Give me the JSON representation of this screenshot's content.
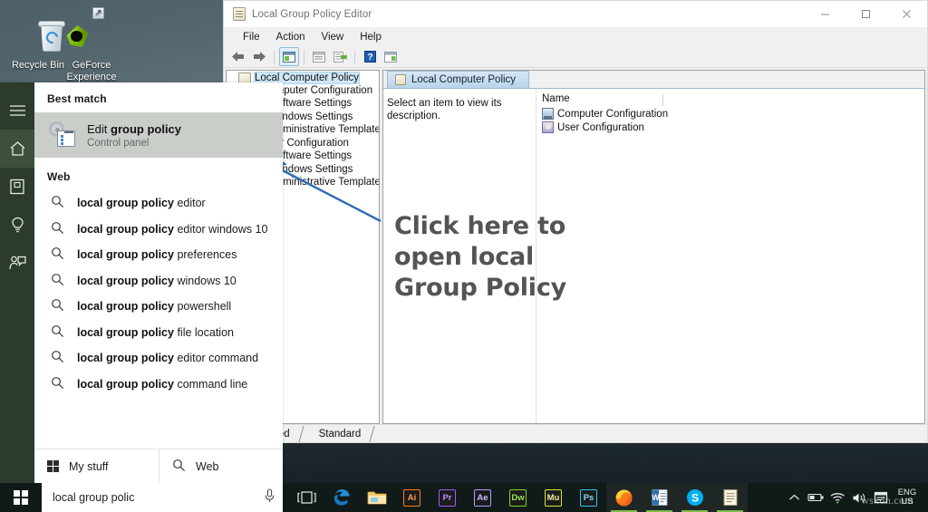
{
  "desktop": {
    "icons": [
      {
        "label": "Recycle Bin",
        "icon": "recycle-bin-icon"
      },
      {
        "label": "GeForce Experience",
        "icon": "geforce-experience-icon"
      }
    ]
  },
  "gpe_window": {
    "title": "Local Group Policy Editor",
    "title_icon": "group-policy-document-icon",
    "window_controls": {
      "minimize": "minimize-icon",
      "maximize": "maximize-icon",
      "close": "close-icon"
    },
    "menu": [
      "File",
      "Action",
      "View",
      "Help"
    ],
    "toolbar": [
      "back-arrow-icon",
      "forward-arrow-icon",
      "show-hide-console-tree-icon",
      "properties-icon",
      "export-list-icon",
      "help-icon",
      "show-hide-action-pane-icon"
    ],
    "tree": {
      "root": {
        "label": "Local Computer Policy",
        "icon": "policy-icon",
        "selected": true
      },
      "nodes": [
        {
          "label": "Computer Configuration",
          "icon": "computer-icon",
          "expander": "v",
          "indent": 1
        },
        {
          "label": "Software Settings",
          "icon": "folder-icon",
          "indent": 2
        },
        {
          "label": "Windows Settings",
          "icon": "folder-icon",
          "indent": 2
        },
        {
          "label": "Administrative Templates",
          "icon": "folder-icon",
          "indent": 2
        },
        {
          "label": "User Configuration",
          "icon": "user-icon",
          "expander": "v",
          "indent": 1
        },
        {
          "label": "Software Settings",
          "icon": "folder-icon",
          "indent": 2
        },
        {
          "label": "Windows Settings",
          "icon": "folder-icon",
          "indent": 2
        },
        {
          "label": "Administrative Templates",
          "icon": "folder-icon",
          "indent": 2
        }
      ]
    },
    "detail": {
      "tab_label": "Local Computer Policy",
      "tab_icon": "policy-icon",
      "description": "Select an item to view its description.",
      "list_header": "Name",
      "list_items": [
        {
          "label": "Computer Configuration",
          "icon": "computer-configuration-icon"
        },
        {
          "label": "User Configuration",
          "icon": "user-configuration-icon"
        }
      ]
    },
    "bottom_tabs": [
      {
        "label": "Extended",
        "active": false
      },
      {
        "label": "Standard",
        "active": true
      }
    ]
  },
  "annotation": {
    "text_lines": [
      "Click here to",
      "open local",
      "Group Policy"
    ],
    "arrow": "blue-outline-arrow",
    "arrow_color": "#2e6db4",
    "text_color": "#545454"
  },
  "search_panel": {
    "rail": [
      {
        "icon": "hamburger-menu-icon",
        "label": "Menu",
        "active": false
      },
      {
        "icon": "home-icon",
        "label": "Home",
        "active": true
      },
      {
        "icon": "notebook-icon",
        "label": "Notebook",
        "active": false
      },
      {
        "icon": "lightbulb-icon",
        "label": "Tips",
        "active": false
      },
      {
        "icon": "feedback-icon",
        "label": "Feedback",
        "active": false
      }
    ],
    "best_match_heading": "Best match",
    "best_match": {
      "title_prefix": "Edit ",
      "title_bold": "group policy",
      "subtitle": "Control panel",
      "icon": "control-panel-gear-icon"
    },
    "web_heading": "Web",
    "web_results": [
      {
        "bold": "local group policy",
        "rest": " editor"
      },
      {
        "bold": "local group policy",
        "rest": " editor windows 10"
      },
      {
        "bold": "local group policy",
        "rest": " preferences"
      },
      {
        "bold": "local group policy",
        "rest": " windows 10"
      },
      {
        "bold": "local group policy",
        "rest": " powershell"
      },
      {
        "bold": "local group policy",
        "rest": " file location"
      },
      {
        "bold": "local group policy",
        "rest": " editor command"
      },
      {
        "bold": "local group policy",
        "rest": " command line"
      }
    ],
    "footer": [
      {
        "label": "My stuff",
        "icon": "windows-grid-icon"
      },
      {
        "label": "Web",
        "icon": "search-icon"
      }
    ]
  },
  "taskbar": {
    "start_icon": "windows-start-icon",
    "search_value": "local group polic",
    "search_mic_icon": "microphone-icon",
    "buttons": [
      {
        "name": "task-view",
        "icon": "task-view-icon",
        "label": "",
        "type": "glyph",
        "running": false
      },
      {
        "name": "microsoft-edge",
        "icon": "edge-icon",
        "label": "e",
        "type": "edge",
        "running": false
      },
      {
        "name": "file-explorer",
        "icon": "file-explorer-icon",
        "label": "",
        "type": "folder",
        "running": false
      },
      {
        "name": "adobe-illustrator",
        "icon": "illustrator-icon",
        "label": "Ai",
        "type": "adobe",
        "color": "#ff7f18",
        "running": false
      },
      {
        "name": "adobe-premiere-pro",
        "icon": "premiere-icon",
        "label": "Pr",
        "type": "adobe",
        "color": "#a259ff",
        "running": false
      },
      {
        "name": "adobe-after-effects",
        "icon": "after-effects-icon",
        "label": "Ae",
        "type": "adobe",
        "color": "#b39bff",
        "running": false
      },
      {
        "name": "adobe-dreamweaver",
        "icon": "dreamweaver-icon",
        "label": "Dw",
        "type": "adobe",
        "color": "#7ed321",
        "running": false
      },
      {
        "name": "adobe-muse",
        "icon": "muse-icon",
        "label": "Mu",
        "type": "adobe",
        "color": "#e3e32a",
        "running": false
      },
      {
        "name": "adobe-photoshop",
        "icon": "photoshop-icon",
        "label": "Ps",
        "type": "adobe",
        "color": "#31c5f0",
        "running": false
      },
      {
        "name": "mozilla-firefox",
        "icon": "firefox-icon",
        "label": "",
        "type": "firefox",
        "running": true
      },
      {
        "name": "office-document",
        "icon": "office-document-icon",
        "label": "",
        "type": "office",
        "running": true
      },
      {
        "name": "skype",
        "icon": "skype-icon",
        "label": "S",
        "type": "skype",
        "running": true
      },
      {
        "name": "local-group-policy-editor",
        "icon": "group-policy-document-icon",
        "label": "",
        "type": "gpe",
        "running": true
      }
    ],
    "tray": {
      "chevron": "show-hidden-icons-chevron",
      "icons": [
        "battery-icon",
        "wifi-icon",
        "volume-icon",
        "action-center-icon"
      ],
      "language": {
        "line1": "ENG",
        "line2": "US"
      }
    },
    "watermark": "wsxdn.com"
  }
}
